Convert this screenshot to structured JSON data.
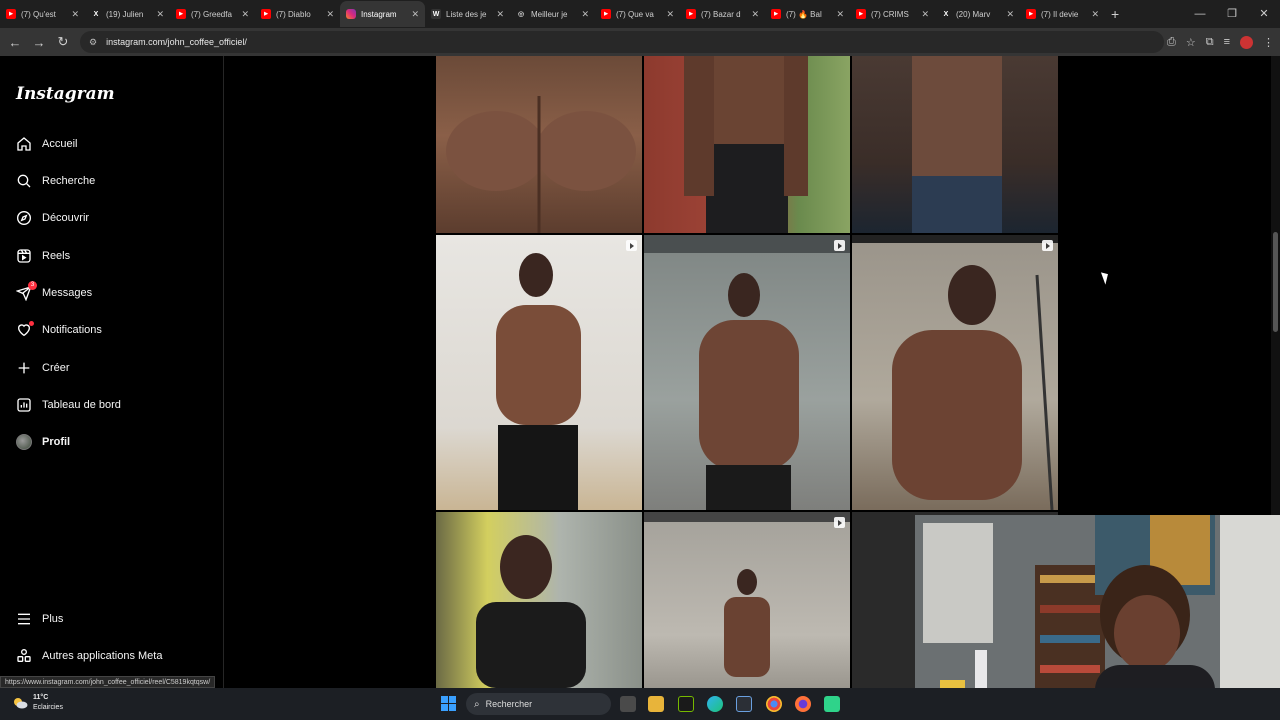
{
  "browser": {
    "tabs": [
      {
        "title": "(7) Qu'est",
        "favicon": "youtube-icon",
        "color": "#ff0000"
      },
      {
        "title": "(19) Julien",
        "favicon": "x-icon",
        "color": "#ffffff"
      },
      {
        "title": "(7) Greedfa",
        "favicon": "youtube-icon",
        "color": "#ff0000"
      },
      {
        "title": "(7) Diablo",
        "favicon": "youtube-icon",
        "color": "#ff0000"
      },
      {
        "title": "Instagram",
        "favicon": "instagram-icon",
        "color": "#e1306c",
        "active": true
      },
      {
        "title": "Liste des je",
        "favicon": "wikipedia-icon",
        "color": "#ffffff"
      },
      {
        "title": "Meilleur je",
        "favicon": "globe-icon",
        "color": "#aaaaaa"
      },
      {
        "title": "(7) Que va",
        "favicon": "youtube-icon",
        "color": "#ff0000"
      },
      {
        "title": "(7) Bazar d",
        "favicon": "youtube-icon",
        "color": "#ff0000"
      },
      {
        "title": "(7) 🔥 Bal",
        "favicon": "youtube-icon",
        "color": "#ff0000"
      },
      {
        "title": "(7) CRIMS",
        "favicon": "youtube-icon",
        "color": "#ff0000"
      },
      {
        "title": "(20) Marv",
        "favicon": "x-icon",
        "color": "#ffffff"
      },
      {
        "title": "(7) Il devie",
        "favicon": "youtube-icon",
        "color": "#ff0000"
      }
    ],
    "new_tab": "+",
    "url": "instagram.com/john_coffee_officiel/",
    "status_url": "https://www.instagram.com/john_coffee_officiel/reel/C5819kqtqsw/"
  },
  "sidebar": {
    "logo": "Instagram",
    "items": [
      {
        "label": "Accueil",
        "icon": "home-icon"
      },
      {
        "label": "Recherche",
        "icon": "search-icon"
      },
      {
        "label": "Découvrir",
        "icon": "compass-icon"
      },
      {
        "label": "Reels",
        "icon": "reels-icon"
      },
      {
        "label": "Messages",
        "icon": "messenger-icon",
        "badge": "3"
      },
      {
        "label": "Notifications",
        "icon": "heart-icon",
        "dot": true
      },
      {
        "label": "Créer",
        "icon": "plus-icon"
      },
      {
        "label": "Tableau de bord",
        "icon": "dashboard-icon"
      },
      {
        "label": "Profil",
        "icon": "avatar"
      }
    ],
    "bottom": [
      {
        "label": "Plus",
        "icon": "menu-icon"
      },
      {
        "label": "Autres applications Meta",
        "icon": "meta-apps-icon"
      }
    ]
  },
  "taskbar": {
    "temperature": "11°C",
    "weather": "Eclaircies",
    "search_placeholder": "Rechercher"
  },
  "colors": {
    "background": "#000000",
    "accent_red": "#ff3040"
  }
}
